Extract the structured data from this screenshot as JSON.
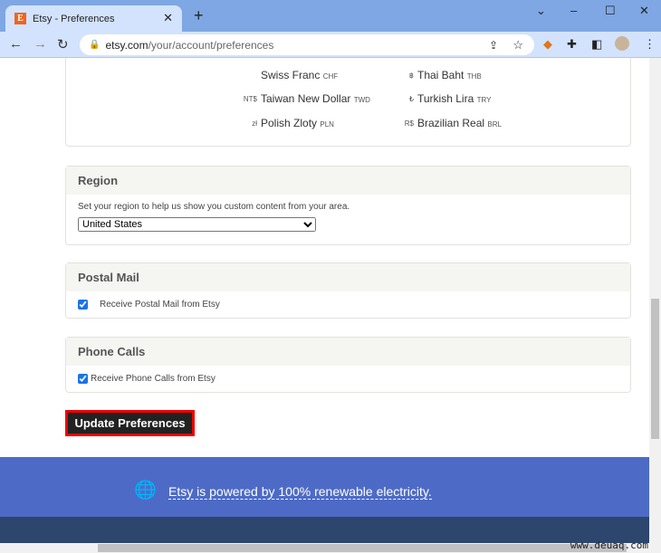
{
  "browser": {
    "tab_title": "Etsy - Preferences",
    "favicon_letter": "E",
    "url_host": "etsy.com",
    "url_path": "/your/account/preferences"
  },
  "currencies": [
    {
      "symbol": "",
      "name": "Swiss Franc",
      "code": "CHF"
    },
    {
      "symbol": "฿",
      "name": "Thai Baht",
      "code": "THB"
    },
    {
      "symbol": "NT$",
      "name": "Taiwan New Dollar",
      "code": "TWD"
    },
    {
      "symbol": "₺",
      "name": "Turkish Lira",
      "code": "TRY"
    },
    {
      "symbol": "zł",
      "name": "Polish Zloty",
      "code": "PLN"
    },
    {
      "symbol": "R$",
      "name": "Brazilian Real",
      "code": "BRL"
    }
  ],
  "region": {
    "title": "Region",
    "description": "Set your region to help us show you custom content from your area.",
    "selected": "United States"
  },
  "postal": {
    "title": "Postal Mail",
    "label": "Receive Postal Mail from Etsy",
    "checked": true
  },
  "phone": {
    "title": "Phone Calls",
    "label": "Receive Phone Calls from Etsy",
    "checked": true
  },
  "update_button": "Update Preferences",
  "footer": {
    "renewable": "Etsy is powered by 100% renewable electricity."
  },
  "watermark": "www.deuaq.com",
  "colors": {
    "footer_blue": "#4d6bc6",
    "footer_navy": "#2d466e",
    "highlight": "#e00000"
  }
}
